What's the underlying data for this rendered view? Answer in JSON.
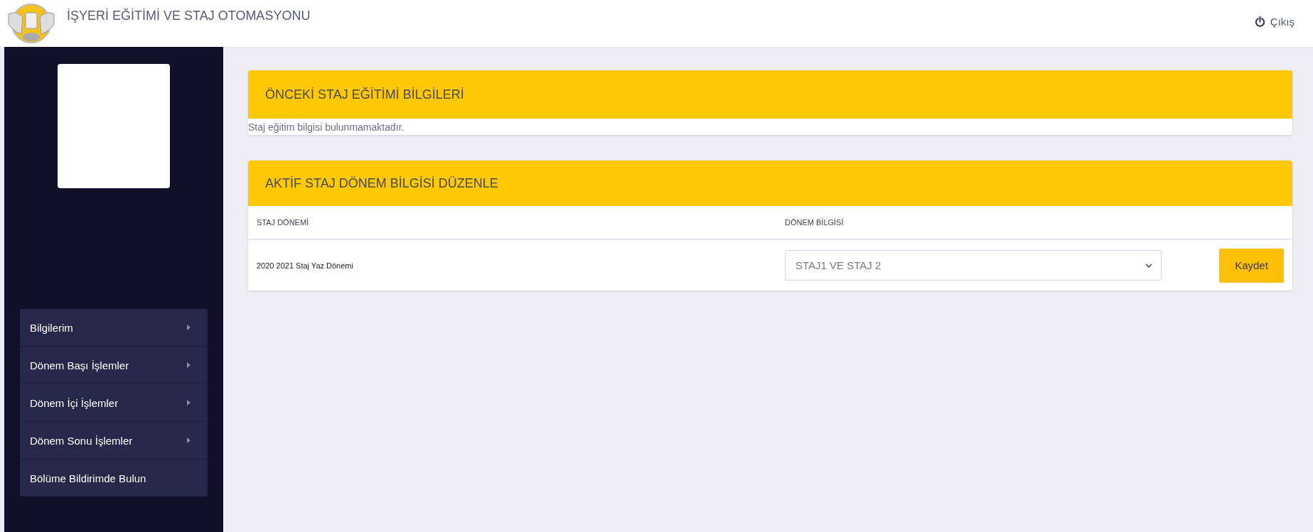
{
  "header": {
    "title": "İŞYERİ EĞİTİMİ VE STAJ OTOMASYONU",
    "logout": "Çıkış"
  },
  "sidebar": {
    "items": [
      {
        "label": "Bilgilerim",
        "kind": "submenu"
      },
      {
        "label": "Dönem Başı İşlemler",
        "kind": "submenu"
      },
      {
        "label": "Dönem İçi İşlemler",
        "kind": "submenu"
      },
      {
        "label": "Dönem Sonu İşlemler",
        "kind": "submenu"
      },
      {
        "label": "Bölüme Bildirimde Bulun",
        "kind": "link"
      }
    ]
  },
  "previous_card": {
    "title": "ÖNCEKİ STAJ EĞİTİMİ BİLGİLERİ",
    "message": "Staj eğitim bilgisi bulunmamaktadır."
  },
  "active_card": {
    "title": "AKTİF STAJ DÖNEM BİLGİSİ DÜZENLE",
    "columns": [
      "STAJ DÖNEMİ",
      "DÖNEM BİLGİSİ"
    ],
    "rows": [
      {
        "period": "2020 2021 Staj Yaz Dönemi",
        "selection": "STAJ1 VE STAJ 2",
        "button": "Kaydet"
      }
    ]
  }
}
